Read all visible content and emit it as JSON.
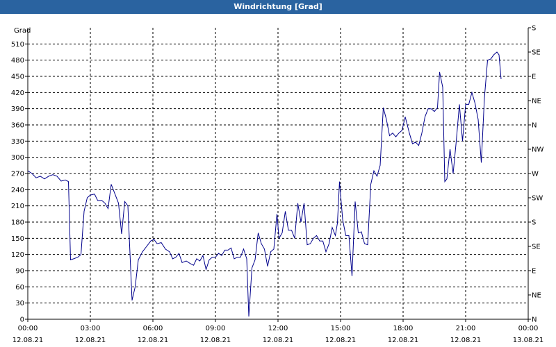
{
  "window": {
    "title": "Windrichtung [Grad]"
  },
  "colors": {
    "titlebar": "#2a63a0",
    "line": "#00008b",
    "grid": "#000000"
  },
  "chart_data": {
    "type": "line",
    "title": "Windrichtung [Grad]",
    "ylabel": "Grad",
    "ylim": [
      0,
      540
    ],
    "y_ticks": [
      0,
      30,
      60,
      90,
      120,
      150,
      180,
      210,
      240,
      270,
      300,
      330,
      360,
      390,
      420,
      450,
      480,
      510
    ],
    "right_axis_labels": [
      {
        "y": 0,
        "label": "N"
      },
      {
        "y": 45,
        "label": "NE"
      },
      {
        "y": 90,
        "label": "E"
      },
      {
        "y": 135,
        "label": "SE"
      },
      {
        "y": 180,
        "label": "S"
      },
      {
        "y": 225,
        "label": "SW"
      },
      {
        "y": 270,
        "label": "W"
      },
      {
        "y": 315,
        "label": "NW"
      },
      {
        "y": 360,
        "label": "N"
      },
      {
        "y": 405,
        "label": "NE"
      },
      {
        "y": 450,
        "label": "E"
      },
      {
        "y": 495,
        "label": "SE"
      },
      {
        "y": 540,
        "label": "S"
      }
    ],
    "xlim": [
      0,
      24
    ],
    "x_ticks": [
      {
        "x": 0,
        "time": "00:00",
        "date": "12.08.21"
      },
      {
        "x": 3,
        "time": "03:00",
        "date": "12.08.21"
      },
      {
        "x": 6,
        "time": "06:00",
        "date": "12.08.21"
      },
      {
        "x": 9,
        "time": "09:00",
        "date": "12.08.21"
      },
      {
        "x": 12,
        "time": "12:00",
        "date": "12.08.21"
      },
      {
        "x": 15,
        "time": "15:00",
        "date": "12.08.21"
      },
      {
        "x": 18,
        "time": "18:00",
        "date": "12.08.21"
      },
      {
        "x": 21,
        "time": "21:00",
        "date": "12.08.21"
      },
      {
        "x": 24,
        "time": "00:00",
        "date": "13.08.21"
      }
    ],
    "grid": true,
    "series": [
      {
        "points": [
          [
            0.0,
            275
          ],
          [
            0.2,
            270
          ],
          [
            0.4,
            262
          ],
          [
            0.6,
            265
          ],
          [
            0.8,
            260
          ],
          [
            1.0,
            265
          ],
          [
            1.2,
            268
          ],
          [
            1.4,
            265
          ],
          [
            1.6,
            256
          ],
          [
            1.8,
            258
          ],
          [
            1.95,
            255
          ],
          [
            2.05,
            110
          ],
          [
            2.2,
            112
          ],
          [
            2.4,
            115
          ],
          [
            2.55,
            120
          ],
          [
            2.7,
            200
          ],
          [
            2.85,
            225
          ],
          [
            3.0,
            230
          ],
          [
            3.2,
            232
          ],
          [
            3.35,
            220
          ],
          [
            3.55,
            220
          ],
          [
            3.7,
            215
          ],
          [
            3.85,
            205
          ],
          [
            4.0,
            250
          ],
          [
            4.2,
            230
          ],
          [
            4.35,
            215
          ],
          [
            4.5,
            158
          ],
          [
            4.65,
            218
          ],
          [
            4.8,
            210
          ],
          [
            5.0,
            35
          ],
          [
            5.15,
            60
          ],
          [
            5.3,
            110
          ],
          [
            5.5,
            125
          ],
          [
            5.7,
            135
          ],
          [
            5.9,
            145
          ],
          [
            6.05,
            148
          ],
          [
            6.2,
            140
          ],
          [
            6.4,
            142
          ],
          [
            6.6,
            130
          ],
          [
            6.8,
            125
          ],
          [
            6.95,
            112
          ],
          [
            7.1,
            115
          ],
          [
            7.25,
            122
          ],
          [
            7.4,
            105
          ],
          [
            7.6,
            108
          ],
          [
            7.8,
            103
          ],
          [
            7.95,
            100
          ],
          [
            8.1,
            112
          ],
          [
            8.25,
            108
          ],
          [
            8.4,
            118
          ],
          [
            8.55,
            92
          ],
          [
            8.7,
            110
          ],
          [
            8.85,
            115
          ],
          [
            9.0,
            115
          ],
          [
            9.15,
            122
          ],
          [
            9.3,
            118
          ],
          [
            9.45,
            128
          ],
          [
            9.6,
            128
          ],
          [
            9.75,
            132
          ],
          [
            9.9,
            112
          ],
          [
            10.05,
            115
          ],
          [
            10.2,
            115
          ],
          [
            10.35,
            130
          ],
          [
            10.5,
            112
          ],
          [
            10.6,
            5
          ],
          [
            10.75,
            95
          ],
          [
            10.9,
            110
          ],
          [
            11.05,
            160
          ],
          [
            11.2,
            140
          ],
          [
            11.35,
            130
          ],
          [
            11.5,
            98
          ],
          [
            11.65,
            125
          ],
          [
            11.8,
            130
          ],
          [
            11.95,
            195
          ],
          [
            12.05,
            150
          ],
          [
            12.2,
            160
          ],
          [
            12.35,
            200
          ],
          [
            12.5,
            165
          ],
          [
            12.65,
            165
          ],
          [
            12.8,
            150
          ],
          [
            12.95,
            215
          ],
          [
            13.1,
            180
          ],
          [
            13.25,
            215
          ],
          [
            13.4,
            138
          ],
          [
            13.55,
            140
          ],
          [
            13.7,
            150
          ],
          [
            13.85,
            155
          ],
          [
            14.0,
            145
          ],
          [
            14.15,
            145
          ],
          [
            14.3,
            125
          ],
          [
            14.45,
            140
          ],
          [
            14.6,
            170
          ],
          [
            14.75,
            155
          ],
          [
            14.85,
            178
          ],
          [
            14.95,
            255
          ],
          [
            15.1,
            185
          ],
          [
            15.25,
            155
          ],
          [
            15.4,
            155
          ],
          [
            15.55,
            80
          ],
          [
            15.7,
            218
          ],
          [
            15.85,
            160
          ],
          [
            16.0,
            162
          ],
          [
            16.15,
            140
          ],
          [
            16.3,
            138
          ],
          [
            16.45,
            250
          ],
          [
            16.6,
            275
          ],
          [
            16.75,
            265
          ],
          [
            16.9,
            285
          ],
          [
            17.05,
            392
          ],
          [
            17.2,
            370
          ],
          [
            17.35,
            340
          ],
          [
            17.5,
            345
          ],
          [
            17.65,
            338
          ],
          [
            17.8,
            345
          ],
          [
            17.95,
            350
          ],
          [
            18.1,
            375
          ],
          [
            18.3,
            345
          ],
          [
            18.45,
            325
          ],
          [
            18.6,
            328
          ],
          [
            18.75,
            322
          ],
          [
            18.9,
            345
          ],
          [
            19.05,
            375
          ],
          [
            19.2,
            390
          ],
          [
            19.35,
            390
          ],
          [
            19.5,
            385
          ],
          [
            19.65,
            392
          ],
          [
            19.75,
            458
          ],
          [
            19.9,
            430
          ],
          [
            20.0,
            255
          ],
          [
            20.1,
            260
          ],
          [
            20.25,
            315
          ],
          [
            20.4,
            270
          ],
          [
            20.55,
            330
          ],
          [
            20.7,
            398
          ],
          [
            20.85,
            330
          ],
          [
            21.0,
            398
          ],
          [
            21.15,
            398
          ],
          [
            21.3,
            420
          ],
          [
            21.45,
            400
          ],
          [
            21.6,
            370
          ],
          [
            21.75,
            290
          ],
          [
            21.9,
            410
          ],
          [
            22.05,
            480
          ],
          [
            22.2,
            482
          ],
          [
            22.35,
            490
          ],
          [
            22.5,
            495
          ],
          [
            22.6,
            490
          ],
          [
            22.7,
            445
          ]
        ]
      }
    ]
  }
}
